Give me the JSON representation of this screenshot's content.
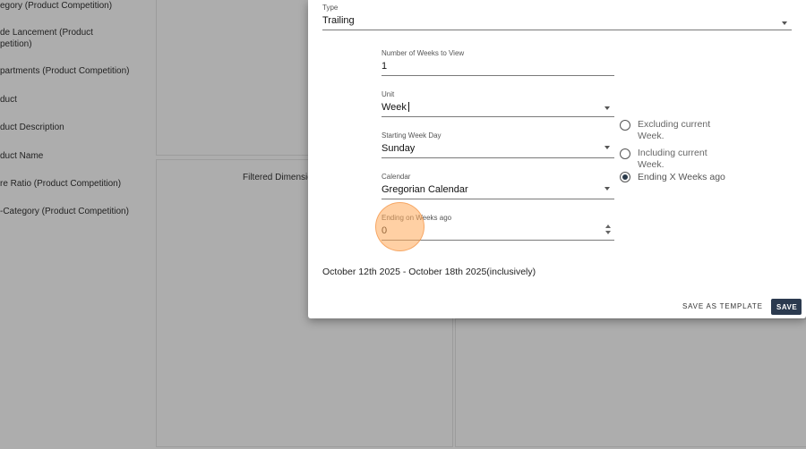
{
  "background": {
    "sidebar_items": [
      "egory (Product Competition)",
      "de Lancement (Product\npetition)",
      "partments (Product Competition)",
      "duct",
      "duct Description",
      "duct Name",
      "re Ratio (Product Competition)",
      "-Category (Product Competition)"
    ],
    "filtered_label": "Filtered Dimensio"
  },
  "dialog": {
    "type_field": {
      "label": "Type",
      "value": "Trailing"
    },
    "weeks_field": {
      "label": "Number of Weeks to View",
      "value": "1"
    },
    "unit_field": {
      "label": "Unit",
      "value": "Week"
    },
    "start_day_field": {
      "label": "Starting Week Day",
      "value": "Sunday"
    },
    "calendar_field": {
      "label": "Calendar",
      "value": "Gregorian Calendar"
    },
    "ending_field": {
      "label": "Ending on Weeks ago",
      "value": "0"
    },
    "radio_options": [
      {
        "label": "Excluding current Week.",
        "checked": false
      },
      {
        "label": "Including current Week.",
        "checked": false
      },
      {
        "label": "Ending X Weeks ago",
        "checked": true
      }
    ],
    "date_range": "October 12th 2025 - October 18th 2025(inclusively)",
    "save_template_label": "SAVE AS TEMPLATE",
    "save_label": "SAVE"
  },
  "colors": {
    "primary_button": "#2b3a4f",
    "click_highlight": "#ffaa5a",
    "overlay": "#000000"
  }
}
